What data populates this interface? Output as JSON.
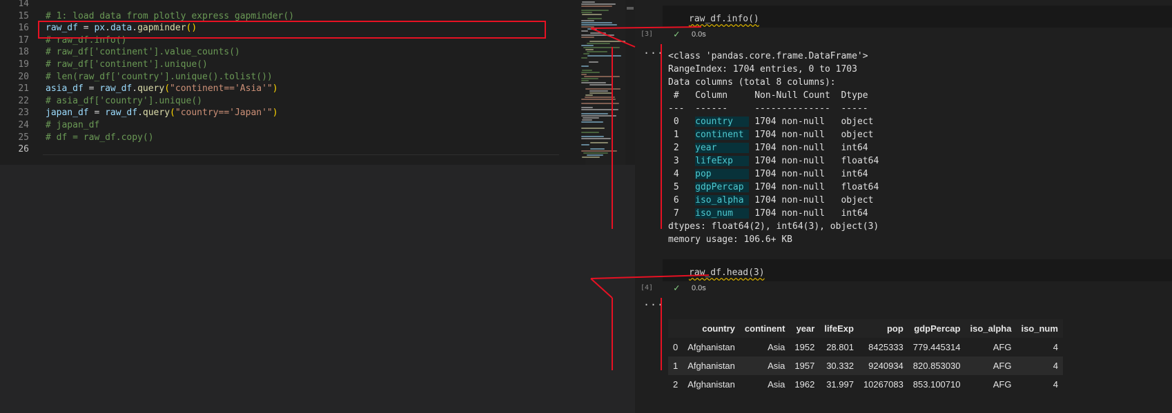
{
  "editor": {
    "lines": [
      {
        "num": "14",
        "tokens": []
      },
      {
        "num": "15",
        "tokens": [
          {
            "c": "tk-c",
            "t": "# 1: load data from plotly express gapminder()"
          }
        ]
      },
      {
        "num": "16",
        "tokens": [
          {
            "c": "tk-v",
            "t": "raw_df"
          },
          {
            "c": "tk-p",
            "t": " = "
          },
          {
            "c": "tk-v",
            "t": "px"
          },
          {
            "c": "tk-p",
            "t": "."
          },
          {
            "c": "tk-v",
            "t": "data"
          },
          {
            "c": "tk-p",
            "t": "."
          },
          {
            "c": "tk-f",
            "t": "gapminder"
          },
          {
            "c": "tk-b",
            "t": "()"
          }
        ]
      },
      {
        "num": "17",
        "tokens": [
          {
            "c": "tk-c",
            "t": "# raw_df.info()"
          }
        ]
      },
      {
        "num": "18",
        "tokens": [
          {
            "c": "tk-c",
            "t": "# raw_df['continent'].value_counts()"
          }
        ]
      },
      {
        "num": "19",
        "tokens": [
          {
            "c": "tk-c",
            "t": "# raw_df['continent'].unique()"
          }
        ]
      },
      {
        "num": "20",
        "tokens": [
          {
            "c": "tk-c",
            "t": "# len(raw_df['country'].unique().tolist())"
          }
        ]
      },
      {
        "num": "21",
        "tokens": [
          {
            "c": "tk-v",
            "t": "asia_df"
          },
          {
            "c": "tk-p",
            "t": " = "
          },
          {
            "c": "tk-v",
            "t": "raw_df"
          },
          {
            "c": "tk-p",
            "t": "."
          },
          {
            "c": "tk-f",
            "t": "query"
          },
          {
            "c": "tk-b",
            "t": "("
          },
          {
            "c": "tk-s",
            "t": "\"continent=='Asia'\""
          },
          {
            "c": "tk-b",
            "t": ")"
          }
        ]
      },
      {
        "num": "22",
        "tokens": [
          {
            "c": "tk-c",
            "t": "# asia_df['country'].unique()"
          }
        ]
      },
      {
        "num": "23",
        "tokens": [
          {
            "c": "tk-v",
            "t": "japan_df"
          },
          {
            "c": "tk-p",
            "t": " = "
          },
          {
            "c": "tk-v",
            "t": "raw_df"
          },
          {
            "c": "tk-p",
            "t": "."
          },
          {
            "c": "tk-f",
            "t": "query"
          },
          {
            "c": "tk-b",
            "t": "("
          },
          {
            "c": "tk-s",
            "t": "\"country=='Japan'\""
          },
          {
            "c": "tk-b",
            "t": ")"
          }
        ]
      },
      {
        "num": "24",
        "tokens": [
          {
            "c": "tk-c",
            "t": "# japan_df"
          }
        ]
      },
      {
        "num": "25",
        "tokens": [
          {
            "c": "tk-c",
            "t": "# df = raw_df.copy()"
          }
        ]
      },
      {
        "num": "26",
        "tokens": []
      }
    ],
    "current_line": "26",
    "highlight_color": "#e81123"
  },
  "cell3": {
    "source": "raw_df.info()",
    "exec_count": "[3]",
    "status_icon": "check-icon",
    "run_time": "0.0s",
    "more": "···",
    "output_header": [
      "<class 'pandas.core.frame.DataFrame'>",
      "RangeIndex: 1704 entries, 0 to 1703",
      "Data columns (total 8 columns):",
      " #   Column     Non-Null Count  Dtype  ",
      "---  ------     --------------  -----  "
    ],
    "columns": [
      {
        "idx": " 0",
        "name": "country",
        "count": "1704 non-null",
        "dtype": "object"
      },
      {
        "idx": " 1",
        "name": "continent",
        "count": "1704 non-null",
        "dtype": "object"
      },
      {
        "idx": " 2",
        "name": "year",
        "count": "1704 non-null",
        "dtype": "int64"
      },
      {
        "idx": " 3",
        "name": "lifeExp",
        "count": "1704 non-null",
        "dtype": "float64"
      },
      {
        "idx": " 4",
        "name": "pop",
        "count": "1704 non-null",
        "dtype": "int64"
      },
      {
        "idx": " 5",
        "name": "gdpPercap",
        "count": "1704 non-null",
        "dtype": "float64"
      },
      {
        "idx": " 6",
        "name": "iso_alpha",
        "count": "1704 non-null",
        "dtype": "object"
      },
      {
        "idx": " 7",
        "name": "iso_num",
        "count": "1704 non-null",
        "dtype": "int64"
      }
    ],
    "output_footer": [
      "dtypes: float64(2), int64(3), object(3)",
      "memory usage: 106.6+ KB"
    ]
  },
  "cell4": {
    "source": "raw_df.head(3)",
    "exec_count": "[4]",
    "status_icon": "check-icon",
    "run_time": "0.0s",
    "more": "···",
    "table": {
      "headers": [
        "",
        "country",
        "continent",
        "year",
        "lifeExp",
        "pop",
        "gdpPercap",
        "iso_alpha",
        "iso_num"
      ],
      "rows": [
        [
          "0",
          "Afghanistan",
          "Asia",
          "1952",
          "28.801",
          "8425333",
          "779.445314",
          "AFG",
          "4"
        ],
        [
          "1",
          "Afghanistan",
          "Asia",
          "1957",
          "30.332",
          "9240934",
          "820.853030",
          "AFG",
          "4"
        ],
        [
          "2",
          "Afghanistan",
          "Asia",
          "1962",
          "31.997",
          "10267083",
          "853.100710",
          "AFG",
          "4"
        ]
      ]
    }
  }
}
